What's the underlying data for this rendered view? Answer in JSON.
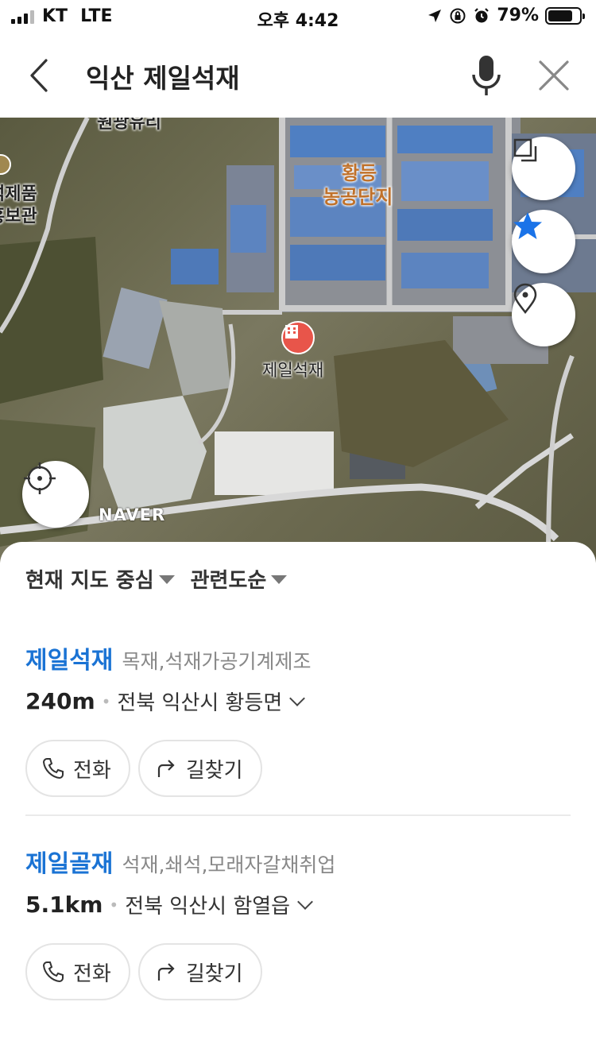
{
  "status_bar": {
    "carrier": "KT",
    "network": "LTE",
    "time": "오후 4:42",
    "battery_percent": "79%",
    "battery_level": 0.79
  },
  "search": {
    "query": "익산 제일석재",
    "back_icon": "chevron-left-icon",
    "mic_icon": "microphone-icon",
    "close_icon": "close-icon"
  },
  "map": {
    "area_label_1": "황등",
    "area_label_2": "농공단지",
    "pin_label": "제일석재",
    "edge_label_top": "원광유리",
    "edge_label_left_1": "석제품",
    "edge_label_left_2": "홍보관",
    "logo": "NAVER",
    "buttons": [
      "layers-icon",
      "star-icon",
      "location-pin-icon",
      "locate-me-icon"
    ],
    "accent_color": "#1a73e8"
  },
  "filters": {
    "sort_center": "현재 지도 중심",
    "sort_relevance": "관련도순"
  },
  "results": [
    {
      "name": "제일석재",
      "category": "목재,석재가공기계제조",
      "distance": "240m",
      "address": "전북 익산시 황등면",
      "call_label": "전화",
      "directions_label": "길찾기"
    },
    {
      "name": "제일골재",
      "category": "석재,쇄석,모래자갈채취업",
      "distance": "5.1km",
      "address": "전북 익산시 함열읍",
      "call_label": "전화",
      "directions_label": "길찾기"
    }
  ]
}
